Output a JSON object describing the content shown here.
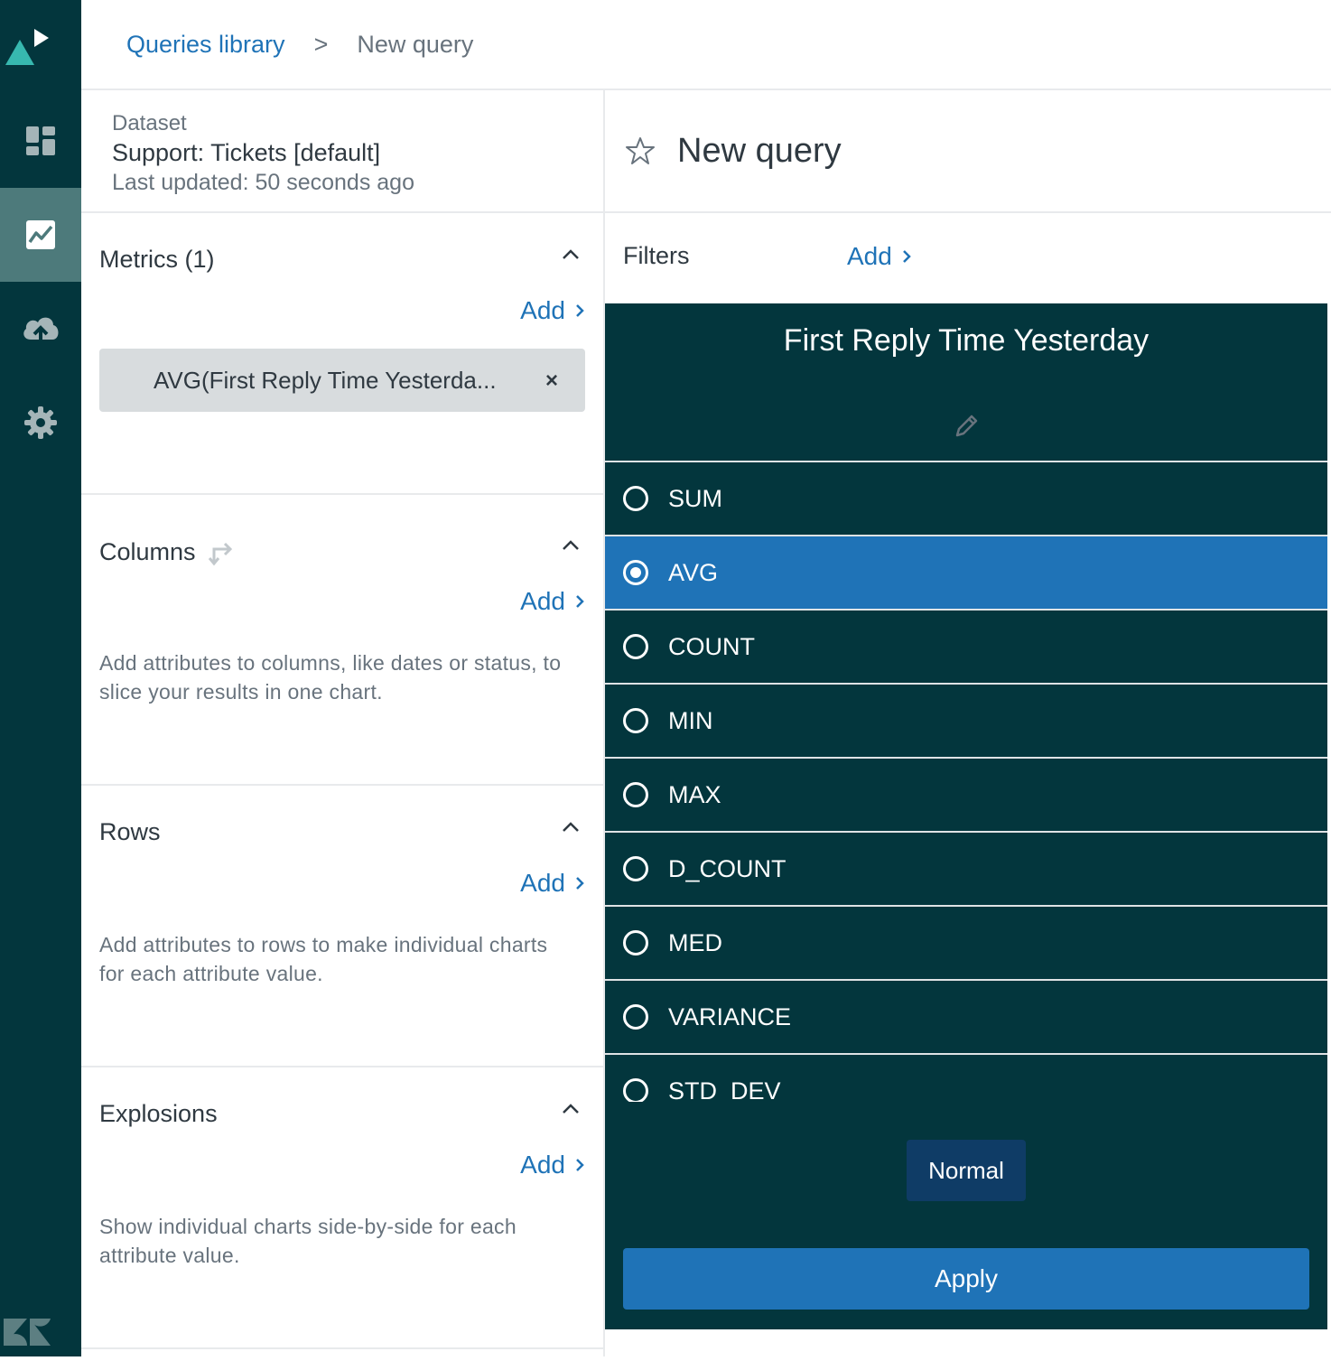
{
  "nav": {
    "items": [
      {
        "icon": "dashboard-icon",
        "active": false
      },
      {
        "icon": "queries-chart-icon",
        "active": true
      },
      {
        "icon": "upload-cloud-icon",
        "active": false
      },
      {
        "icon": "settings-gear-icon",
        "active": false
      }
    ]
  },
  "breadcrumb": {
    "library": "Queries library",
    "separator": ">",
    "current": "New query"
  },
  "dataset": {
    "label": "Dataset",
    "name": "Support: Tickets [default]",
    "updated": "Last updated: 50 seconds ago"
  },
  "sections": {
    "metrics": {
      "title": "Metrics (1)",
      "add": "Add",
      "pill": "AVG(First Reply Time Yesterda...",
      "pill_remove": "×"
    },
    "columns": {
      "title": "Columns",
      "add": "Add",
      "help": "Add attributes to columns, like dates or status, to slice your results in one chart."
    },
    "rows": {
      "title": "Rows",
      "add": "Add",
      "help": "Add attributes to rows to make individual charts for each attribute value."
    },
    "explosions": {
      "title": "Explosions",
      "add": "Add",
      "help": "Show individual charts side-by-side for each attribute value."
    }
  },
  "query": {
    "title": "New query"
  },
  "filters": {
    "label": "Filters",
    "add": "Add"
  },
  "popover": {
    "title": "First Reply Time Yesterday",
    "options": [
      "SUM",
      "AVG",
      "COUNT",
      "MIN",
      "MAX",
      "D_COUNT",
      "MED",
      "VARIANCE",
      "STD_DEV"
    ],
    "selected": "AVG",
    "normal_label": "Normal",
    "apply_label": "Apply"
  },
  "colors": {
    "rail": "#03363d",
    "rail_active": "#4d7a7b",
    "link": "#1f73b7",
    "popover_bg": "#03363d",
    "selected_bg": "#1f73b7",
    "logo_teal": "#37b8af"
  }
}
